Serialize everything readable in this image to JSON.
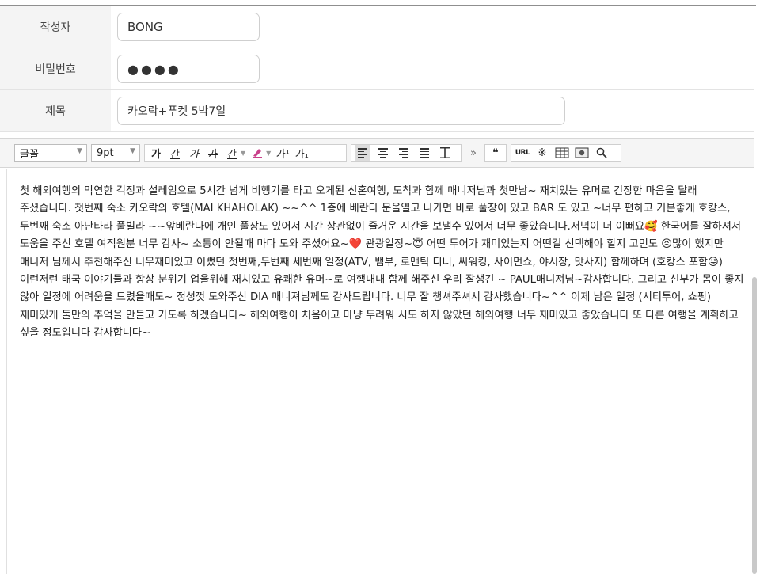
{
  "form": {
    "author": {
      "label": "작성자",
      "value": "BONG"
    },
    "password": {
      "label": "비밀번호",
      "value": "●●●●"
    },
    "title": {
      "label": "제목",
      "value": "카오락+푸켓 5박7일"
    }
  },
  "toolbar": {
    "font_select": "글꼴",
    "size_select": "9pt",
    "bold": "가",
    "underline": "간",
    "italic": "가",
    "strike": "가",
    "font_color": "간",
    "superscript": "가¹",
    "subscript": "가₁",
    "more": "»",
    "quote": "❝",
    "url": "URL",
    "special_char": "※"
  },
  "content": {
    "paragraphs": [
      "첫 해외여행의 막연한 걱정과 설레임으로  5시간 넘게  비행기를 타고 오게된 신혼여행,  도착과 함께  매니저님과 첫만남~ 재치있는 유머로 긴장한 마음을 달래 주셨습니다. 첫번째 숙소 카오락의  호텔(MAI KHAHOLAK) ~~^^  1층에 베란다 문을열고 나가면 바로 풀장이 있고 BAR 도 있고 ~너무 편하고 기분좋게 호캉스, 두번째 숙소 아난타라 풀빌라 ~~앞베란다에 개인 풀장도 있어서 시간 상관없이 즐거운 시간을 보낼수 있어서 너무 좋았습니다.저녁이 더  이뻐요🥰  한국어를 잘하셔서 도움을 주신 호텔 여직원분 너무 감사~ 소통이 안될때 마다 도와 주셨어요~❤️ 관광일정~😇 어떤 투어가 재미있는지 어떤걸 선택해야 할지 고민도 😣많이 했지만 매니저 님께서 추천해주신  너무재미있고 이뻤던 첫번째,두번째 세번째  일정(ATV, 뱀부, 로맨틱 디너, 씨워킹, 사이먼쇼, 야시장, 맛사지) 함께하며  (호캉스 포함😜) 이런저런 태국 이야기들과 항상 분위기 업을위해 재치있고 유쾌한 유머~로 여행내내 함께 해주신 우리 잘생긴 ~ PAUL매니져님~감사합니다.  그리고 신부가 몸이 좋지 않아 일정에 어려움을 드렸을때도~ 정성껏 도와주신 DIA 매니져님께도 감사드립니다. 너무 잘 챙셔주셔서 감사했습니다~^^ 이제 남은 일정 (시티투어, 쇼핑) 재미있게  둘만의 추억을 만들고 가도록 하겠습니다~  해외여행이 처음이고 마냥 두려워 시도 하지 않았던 해외여행 너무 재미있고 좋았습니다  또 다른 여행을 계획하고 싶을 정도입니다  감사합니다~"
    ]
  },
  "icons": [
    "dropdown-arrow-icon",
    "align-left-icon",
    "align-center-icon",
    "align-right-icon",
    "align-justify-icon",
    "line-height-icon",
    "quote-icon",
    "special-char-icon",
    "table-icon",
    "image-icon",
    "search-icon"
  ]
}
